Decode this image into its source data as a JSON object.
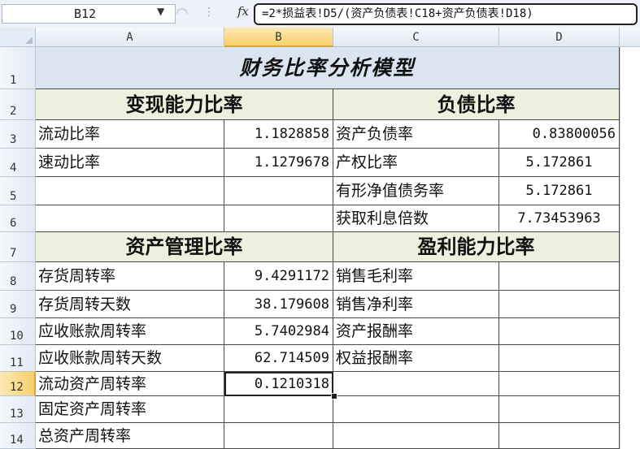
{
  "formula_bar": {
    "name_box": "B12",
    "fx_label": "fx",
    "formula": "=2*损益表!D5/(资产负债表!C18+资产负债表!D18)"
  },
  "columns": [
    "A",
    "B",
    "C",
    "D"
  ],
  "rows": [
    "1",
    "2",
    "3",
    "4",
    "5",
    "6",
    "7",
    "8",
    "9",
    "10",
    "11",
    "12",
    "13",
    "14"
  ],
  "sheet": {
    "title": "财务比率分析模型",
    "sections": {
      "liquidity": "变现能力比率",
      "debt": "负债比率",
      "asset_mgmt": "资产管理比率",
      "profitability": "盈利能力比率"
    },
    "liquidity_rows": [
      {
        "label": "流动比率",
        "value": "1.1828858"
      },
      {
        "label": "速动比率",
        "value": "1.1279678"
      }
    ],
    "debt_rows": [
      {
        "label": "资产负债率",
        "value": "0.83800056"
      },
      {
        "label": "产权比率",
        "value": "5.172861"
      },
      {
        "label": "有形净值债务率",
        "value": "5.172861"
      },
      {
        "label": "获取利息倍数",
        "value": "7.73453963"
      }
    ],
    "asset_rows": [
      {
        "label": "存货周转率",
        "value": "9.4291172"
      },
      {
        "label": "存货周转天数",
        "value": "38.179608"
      },
      {
        "label": "应收账款周转率",
        "value": "5.7402984"
      },
      {
        "label": "应收账款周转天数",
        "value": "62.714509"
      },
      {
        "label": "流动资产周转率",
        "value": "0.1210318"
      },
      {
        "label": "固定资产周转率",
        "value": ""
      },
      {
        "label": "总资产周转率",
        "value": ""
      }
    ],
    "profit_rows": [
      {
        "label": "销售毛利率",
        "value": ""
      },
      {
        "label": "销售净利率",
        "value": ""
      },
      {
        "label": "资产报酬率",
        "value": ""
      },
      {
        "label": "权益报酬率",
        "value": ""
      }
    ]
  },
  "colors": {
    "title_fill": "#dbe5f1",
    "section_fill": "#ecf1de",
    "selected_header": "#f8cf6a"
  }
}
